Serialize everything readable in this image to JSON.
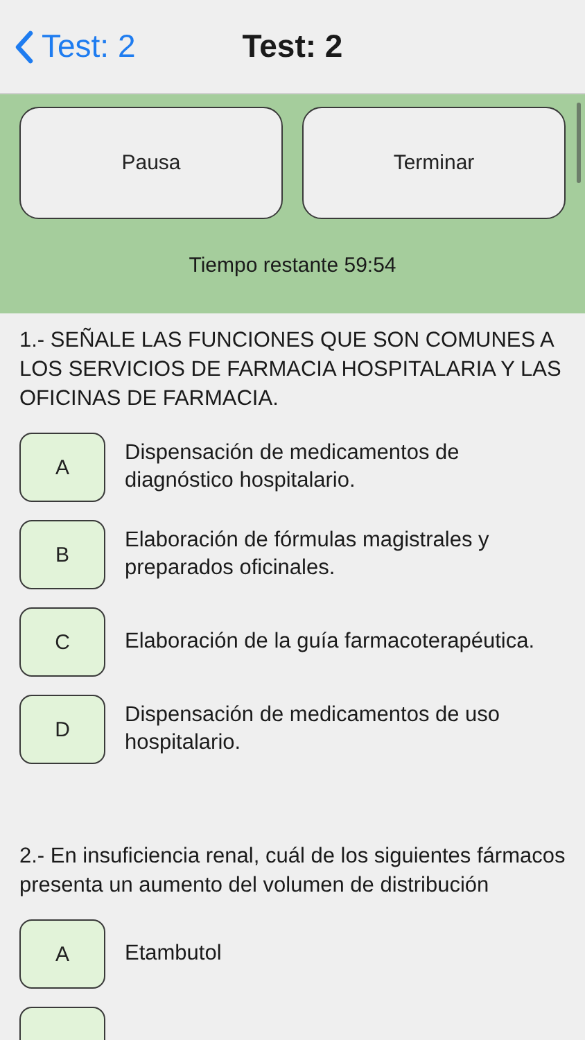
{
  "nav": {
    "back": "Test: 2",
    "title": "Test: 2"
  },
  "controls": {
    "buttons": [
      "Pausa",
      "Terminar"
    ],
    "timer": "Tiempo restante 59:54"
  },
  "questions": [
    {
      "text": "1.- SEÑALE LAS FUNCIONES QUE SON COMUNES A LOS SERVICIOS DE FARMACIA HOSPITALARIA Y LAS OFICINAS DE FARMACIA.",
      "options": [
        {
          "kind": "full",
          "letter": "A",
          "text": "Dispensación de medicamentos de diagnóstico hospitalario."
        },
        {
          "kind": "full",
          "letter": "B",
          "text": "Elaboración de fórmulas magistrales y preparados oficinales."
        },
        {
          "kind": "full",
          "letter": "C",
          "text": "Elaboración de la guía farmacoterapéutica."
        },
        {
          "kind": "full",
          "letter": "D",
          "text": "Dispensación de medicamentos de uso hospitalario."
        }
      ]
    },
    {
      "text": "2.- En insuficiencia renal, cuál de los siguientes fármacos presenta un aumento del volumen de distribución",
      "options": [
        {
          "kind": "full",
          "letter": "A",
          "text": "Etambutol"
        },
        {
          "kind": "cut"
        }
      ]
    }
  ]
}
